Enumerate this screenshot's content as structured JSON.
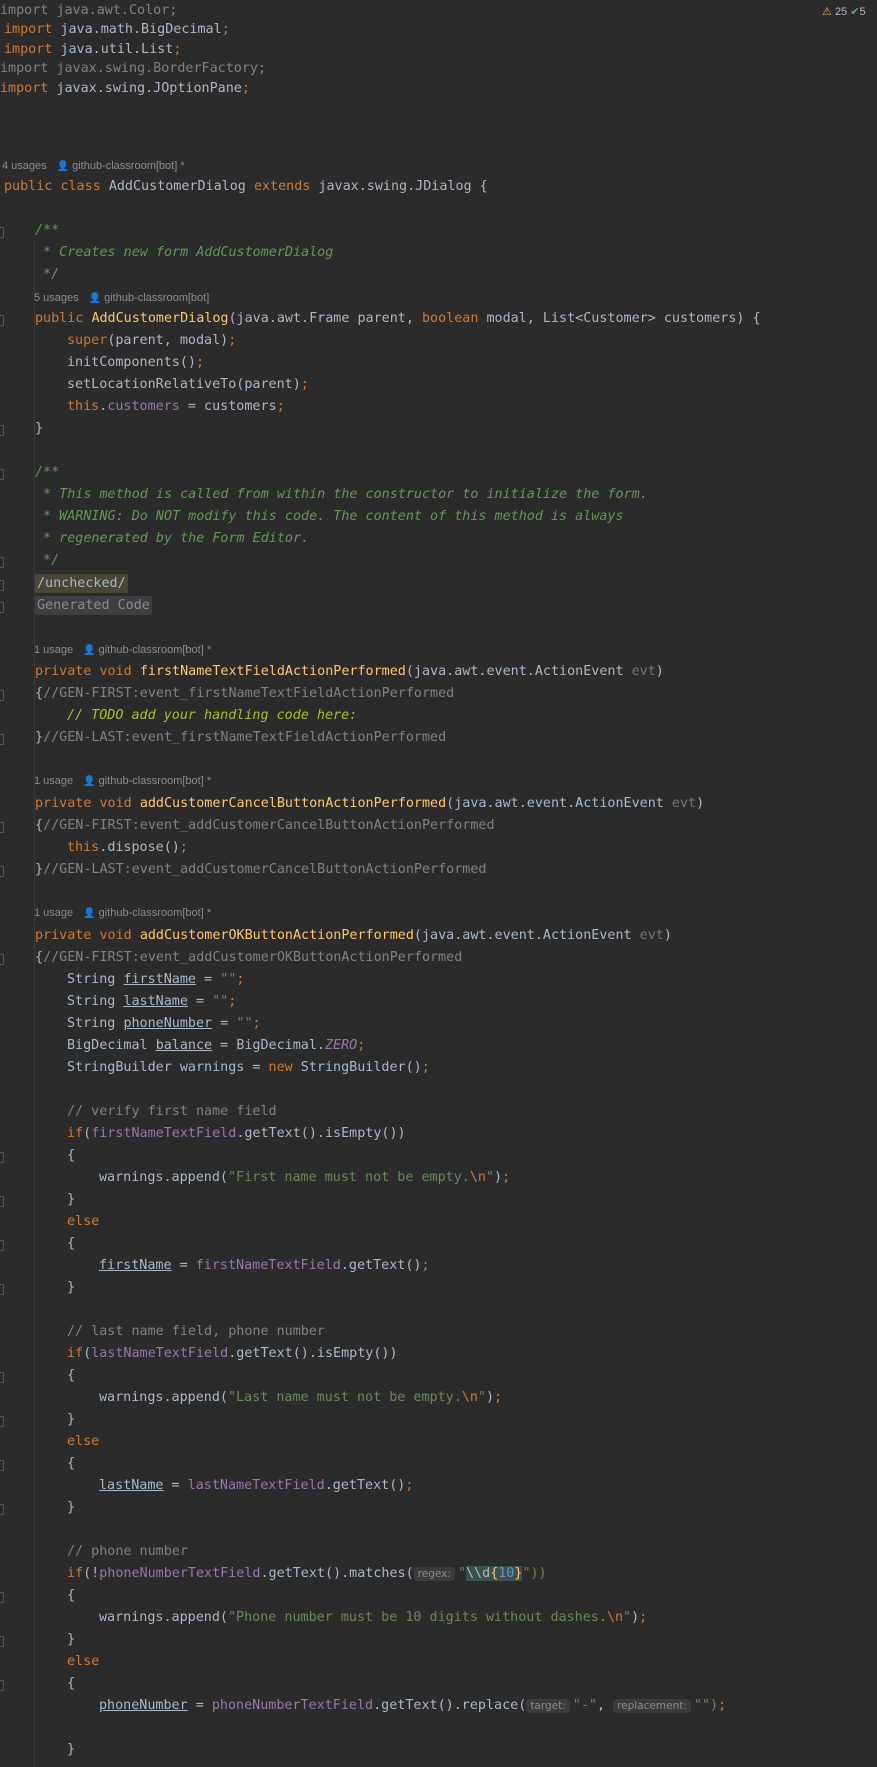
{
  "status": {
    "warnings_count": "25",
    "ok_count": "5"
  },
  "inlays": {
    "class_usage": "4 usages",
    "class_author": "github-classroom[bot] *",
    "ctor_usage": "5 usages",
    "ctor_author": "github-classroom[bot]",
    "m1_usage": "1 usage",
    "m1_author": "github-classroom[bot] *",
    "m2_usage": "1 usage",
    "m2_author": "github-classroom[bot] *",
    "m3_usage": "1 usage",
    "m3_author": "github-classroom[bot] *"
  },
  "code": {
    "imp1": "java.awt.Color;",
    "imp2": "java.math.BigDecimal",
    "imp3": "java.util.List",
    "imp4": "javax.swing.BorderFactory;",
    "imp5": "javax.swing.JOptionPane",
    "kw_import": "import",
    "kw_public": "public",
    "kw_class": "class",
    "class_name": "AddCustomerDialog",
    "kw_extends": "extends",
    "super_class": "javax.swing.JDialog {",
    "doc1": "/**",
    "doc2": " * Creates new form AddCustomerDialog",
    "doc3": " */",
    "ctor_name": "AddCustomerDialog",
    "ctor_p1": "(java.awt.Frame parent,",
    "kw_boolean": "boolean",
    "ctor_p2": "modal, List<Customer> customers) {",
    "kw_super": "super",
    "super_args": "(parent, modal)",
    "init_call": "initComponents()",
    "setloc_call": "setLocationRelativeTo(parent)",
    "kw_this": "this",
    "customers_field": "customers",
    "assign_customers": " = customers",
    "brace_close": "}",
    "doc4": "/**",
    "doc5": " * This method is called from within the constructor to initialize the form.",
    "doc6": " * WARNING: Do NOT modify this code. The content of this method is always",
    "doc7": " * regenerated by the Form Editor.",
    "doc8": " */",
    "fold_unchecked": "/unchecked/",
    "fold_generated": "Generated Code",
    "kw_private": "private",
    "kw_void": "void",
    "m1_name": "firstNameTextFieldActionPerformed",
    "action_event": "(java.awt.event.ActionEvent",
    "evt": "evt",
    "m1_gen_first": "//GEN-FIRST:event_firstNameTextFieldActionPerformed",
    "todo": "// TODO add your handling code here:",
    "m1_gen_last": "//GEN-LAST:event_firstNameTextFieldActionPerformed",
    "m2_name": "addCustomerCancelButtonActionPerformed",
    "m2_gen_first": "//GEN-FIRST:event_addCustomerCancelButtonActionPerformed",
    "dispose": "dispose()",
    "m2_gen_last": "//GEN-LAST:event_addCustomerCancelButtonActionPerformed",
    "m3_name": "addCustomerOKButtonActionPerformed",
    "m3_gen_first": "//GEN-FIRST:event_addCustomerOKButtonActionPerformed",
    "t_string": "String",
    "v_first": "firstName",
    "v_last": "lastName",
    "v_phone": "phoneNumber",
    "t_bigdecimal": "BigDecimal",
    "v_balance": "balance",
    "eq": " = ",
    "empty_str": "\"\"",
    "bigdecimal_ref": "BigDecimal.",
    "zero": "ZERO",
    "sb_decl": "StringBuilder warnings = ",
    "kw_new": "new",
    "sb_ctor": " StringBuilder()",
    "c_verify_first": "// verify first name field",
    "kw_if": "if",
    "first_field": "firstNameTextField",
    "get_text_is_empty": ".getText().isEmpty())",
    "open_brace": "{",
    "append_call": "warnings.append(",
    "msg_first": "\"First name must not be empty.",
    "esc_n": "\\n",
    "quote_close": "\"",
    "kw_else": "else",
    "get_text": ".getText()",
    "c_last_phone": "// last name field, phone number",
    "last_field": "lastNameTextField",
    "msg_last": "\"Last name must not be empty.",
    "c_phone": "// phone number",
    "phone_field": "phoneNumberTextField",
    "matches_call": ".getText().matches(",
    "hint_regex": "regex:",
    "regex_open": "\"",
    "regex_body": "\\\\d",
    "regex_brace_open": "{",
    "regex_num": "10",
    "regex_brace_close": "}",
    "regex_close": "\"))",
    "msg_phone": "\"Phone number must be 10 digits without dashes.",
    "replace_call": ".getText().replace(",
    "hint_target": "target:",
    "dash_str": "\"-\"",
    "hint_replacement": "replacement:",
    "replace_end": "\"\")"
  }
}
